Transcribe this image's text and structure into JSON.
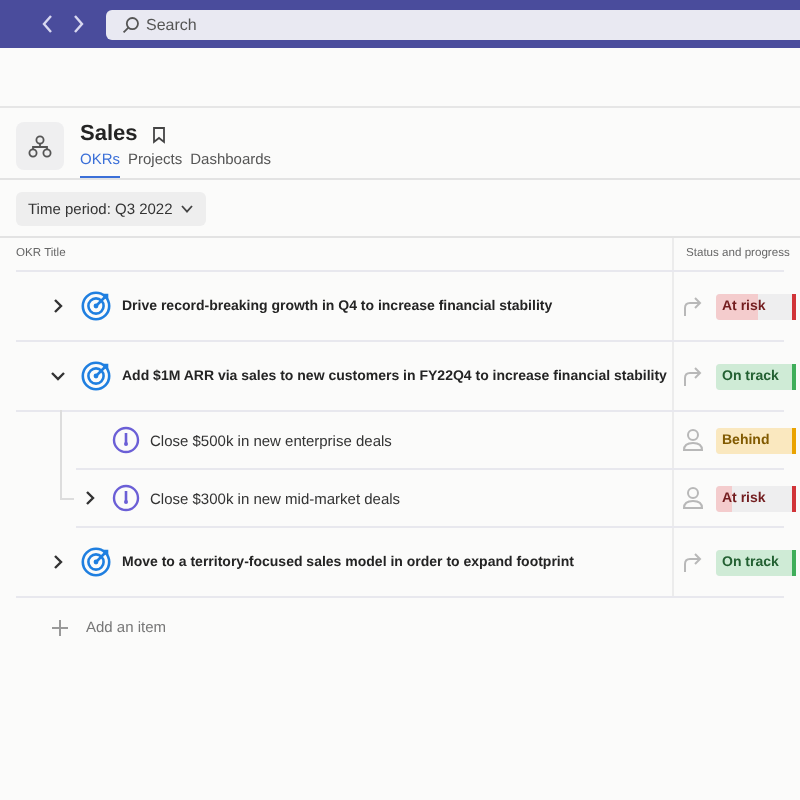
{
  "search": {
    "placeholder": "Search"
  },
  "header": {
    "title": "Sales",
    "tabs": [
      {
        "label": "OKRs",
        "selected": true
      },
      {
        "label": "Projects",
        "selected": false
      },
      {
        "label": "Dashboards",
        "selected": false
      }
    ]
  },
  "filter": {
    "label": "Time period: Q3 2022"
  },
  "table": {
    "columns": [
      "OKR Title",
      "Status and progress"
    ],
    "rows": [
      {
        "kind": "objective",
        "title": "Drive record-breaking growth in Q4 to increase financial stability",
        "expanded": false,
        "status": "At risk",
        "color": "#d13438",
        "level": 0.55,
        "children": []
      },
      {
        "kind": "objective",
        "title": "Add $1M ARR via sales to new customers in FY22Q4 to increase financial stability",
        "expanded": true,
        "status": "On track",
        "color": "#3fae5a",
        "level": 1,
        "children": [
          {
            "kind": "key_result",
            "title": "Close $500k in new enterprise deals",
            "status": "Behind",
            "color": "#eaa300",
            "level": 1
          },
          {
            "kind": "key_result",
            "title": "Close $300k in new mid-market deals",
            "expanded": false,
            "status": "At risk",
            "color": "#d13438",
            "level": 0.2
          }
        ]
      },
      {
        "kind": "objective",
        "title": "Move to a territory-focused sales model in order to expand footprint",
        "expanded": false,
        "status": "On track",
        "color": "#3fae5a",
        "level": 1,
        "children": []
      }
    ]
  },
  "add_item": "Add an item"
}
